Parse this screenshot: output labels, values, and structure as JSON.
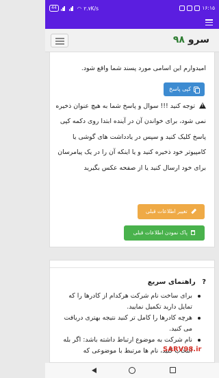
{
  "status_bar": {
    "time": "۱۶:۱۵",
    "network_speed": "۲.۷K/s",
    "battery": "44"
  },
  "navbar": {
    "brand_text": "سرو",
    "brand_number": "۹۸"
  },
  "answer_card": {
    "intro_text": "امیدوارم این اسامی مورد پسند شما واقع شود.",
    "copy_button_label": "کپی پاسخ",
    "warning_text": "توجه کنید !!! سوال و پاسخ شما به هیچ عنوان ذخیره نمی شود، برای خواندن آن در آینده ابتدا روی دکمه کپی پاسخ کلیک کنید و سپس در یادداشت های گوشی یا کامپیوتر خود ذخیره کنید و یا اینکه آن را در یک پیامرسان برای خود ارسال کنید یا از صفحه عکس بگیرید",
    "change_button_label": "تغییر اطلاعات قبلی",
    "clear_button_label": "پاک نمودن اطلاعات قبلی"
  },
  "guide": {
    "title": "راهنمای سریع",
    "items": [
      "برای ساخت نام شرکت هرکدام از کادرها را که تمایل دارید تکمیل نمایید.",
      "هرچه کادرها را کامل تر کنید نتیجه بهتری دریافت می کنید.",
      "نام شرکت به موضوع ارتباط داشته باشد: اگر بله انتخاب کنید، نام ها مرتبط با موضوعی که"
    ]
  },
  "watermark": "SARV98.ir",
  "colors": {
    "status_bar": "#5b1ee0",
    "copy_button": "#3d8bd1",
    "orange_button": "#efaa46",
    "green_button": "#49b24c",
    "brand_number": "#2e7d32"
  }
}
